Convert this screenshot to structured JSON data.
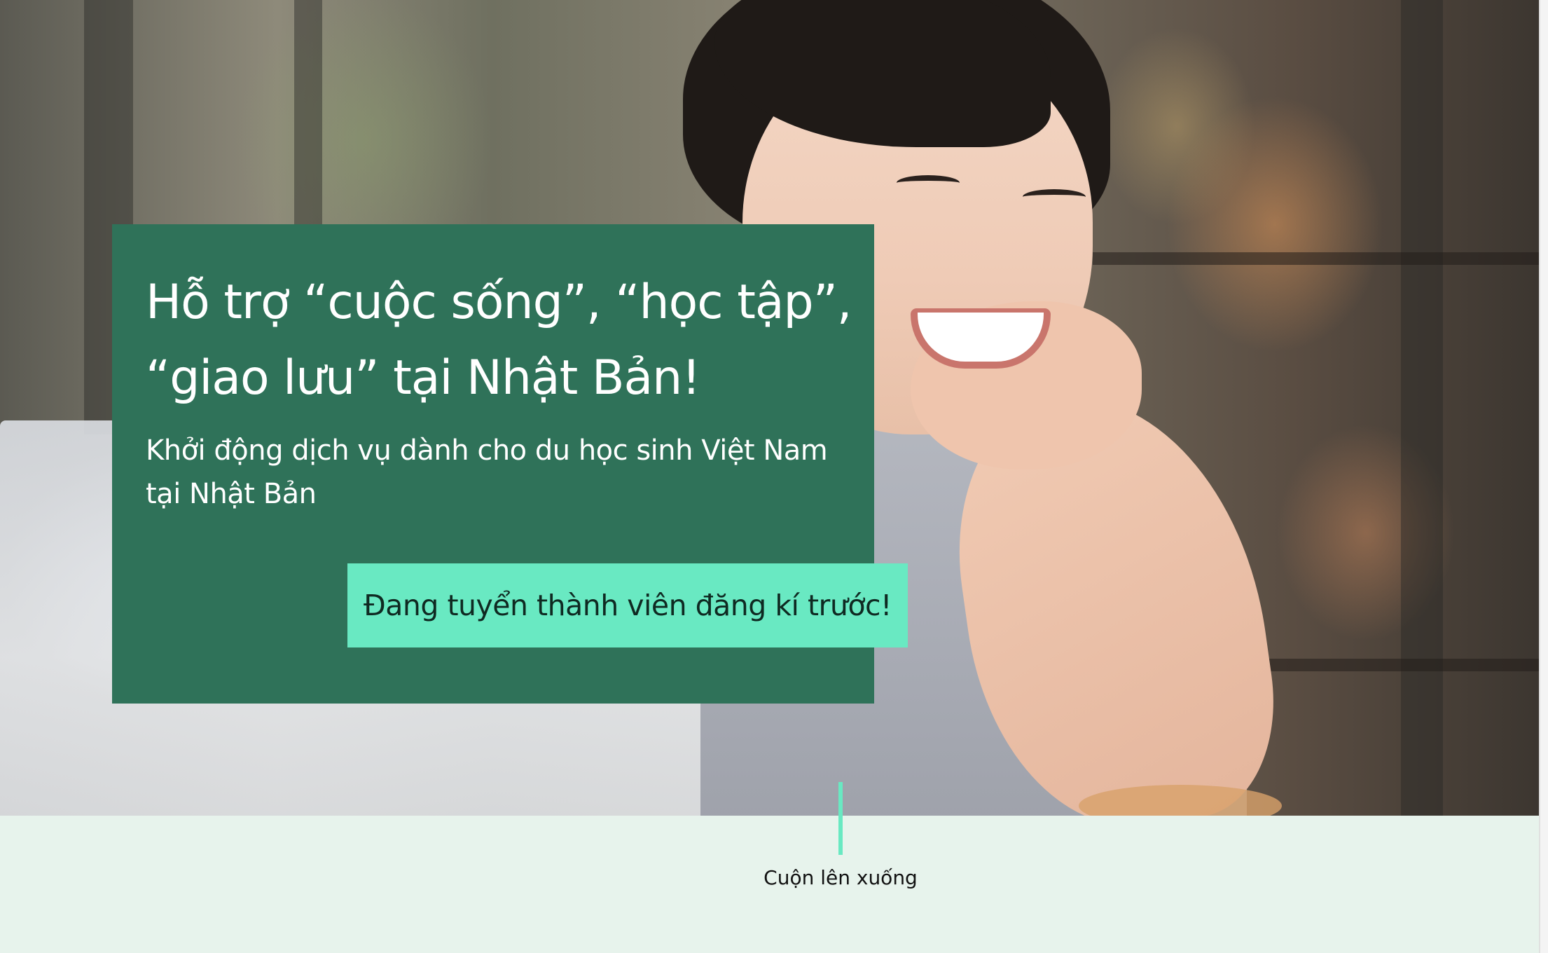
{
  "hero": {
    "title_line1": "Hỗ trợ “cuộc sống”, “học tập”,",
    "title_line2": "“giao lưu” tại Nhật Bản!",
    "subtitle_line1": "Khởi động dịch vụ dành cho du học sinh Việt Nam",
    "subtitle_line2": "tại Nhật Bản",
    "cta_label": "Đang tuyển thành viên đăng kí trước!"
  },
  "scroll": {
    "label": "Cuộn lên xuống"
  },
  "colors": {
    "card_green": "#2f7259",
    "accent_mint": "#69e9c2",
    "band_bg": "#e7f3ec"
  }
}
